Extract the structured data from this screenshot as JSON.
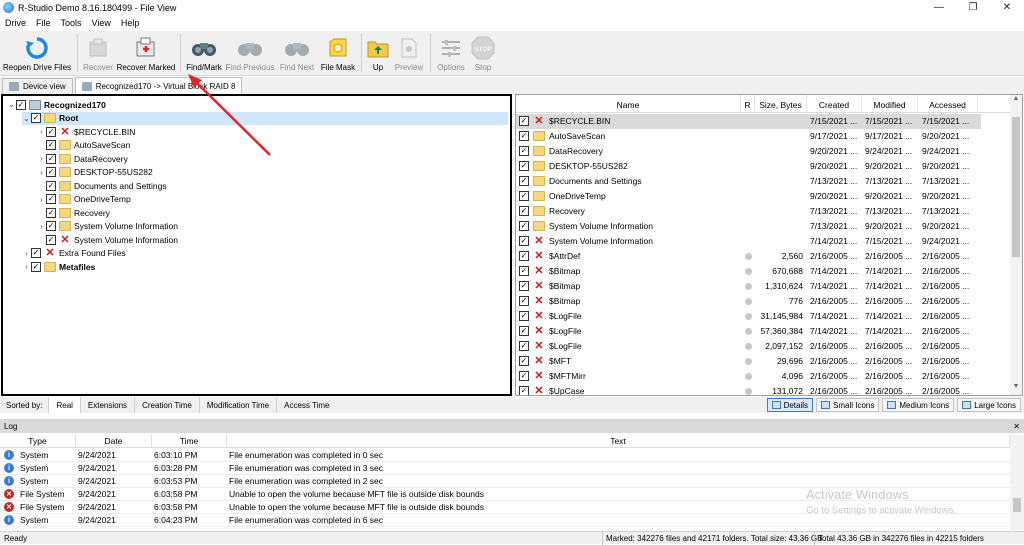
{
  "window": {
    "title": "R-Studio Demo 8.16.180499 - File View",
    "minimize": "—",
    "maximize": "❐",
    "close": "✕"
  },
  "menu": [
    "Drive",
    "File",
    "Tools",
    "View",
    "Help"
  ],
  "toolbar": [
    {
      "label": "Reopen Drive Files",
      "icon": "reopen-icon",
      "enabled": true
    },
    {
      "label": "Recover",
      "icon": "recover-icon",
      "enabled": false
    },
    {
      "label": "Recover Marked",
      "icon": "recover-marked-icon",
      "enabled": true
    },
    {
      "label": "Find/Mark",
      "icon": "binoculars-icon",
      "enabled": true
    },
    {
      "label": "Find Previous",
      "icon": "binoculars-icon",
      "enabled": false
    },
    {
      "label": "Find Next",
      "icon": "binoculars-icon",
      "enabled": false
    },
    {
      "label": "File Mask",
      "icon": "file-mask-icon",
      "enabled": true
    },
    {
      "label": "Up",
      "icon": "folder-up-icon",
      "enabled": true
    },
    {
      "label": "Preview",
      "icon": "preview-icon",
      "enabled": false
    },
    {
      "label": "Options",
      "icon": "options-icon",
      "enabled": false
    },
    {
      "label": "Stop",
      "icon": "stop-icon",
      "enabled": false,
      "badge": "STOP"
    }
  ],
  "tabs": [
    {
      "label": "Device view",
      "active": false
    },
    {
      "label": "Recognized170 -> Virtual Block RAID 8",
      "active": true
    }
  ],
  "tree": [
    {
      "label": "Recognized170",
      "level": 0,
      "expander": "⌄",
      "checked": true,
      "icon": "drive",
      "bold": true
    },
    {
      "label": "Root",
      "level": 1,
      "expander": "⌄",
      "checked": true,
      "icon": "folder",
      "bold": true,
      "selected": true
    },
    {
      "label": "$RECYCLE.BIN",
      "level": 2,
      "expander": "›",
      "checked": true,
      "icon": "deleted"
    },
    {
      "label": "AutoSaveScan",
      "level": 2,
      "expander": "",
      "checked": true,
      "icon": "folder"
    },
    {
      "label": "DataRecovery",
      "level": 2,
      "expander": "›",
      "checked": true,
      "icon": "folder"
    },
    {
      "label": "DESKTOP-55US282",
      "level": 2,
      "expander": "›",
      "checked": true,
      "icon": "folder"
    },
    {
      "label": "Documents and Settings",
      "level": 2,
      "expander": "",
      "checked": true,
      "icon": "folder"
    },
    {
      "label": "OneDriveTemp",
      "level": 2,
      "expander": "›",
      "checked": true,
      "icon": "folder"
    },
    {
      "label": "Recovery",
      "level": 2,
      "expander": "",
      "checked": true,
      "icon": "folder"
    },
    {
      "label": "System Volume Information",
      "level": 2,
      "expander": "›",
      "checked": true,
      "icon": "folder"
    },
    {
      "label": "System Volume Information",
      "level": 2,
      "expander": "",
      "checked": true,
      "icon": "deleted"
    },
    {
      "label": "Extra Found Files",
      "level": 1,
      "expander": "›",
      "checked": true,
      "icon": "deleted"
    },
    {
      "label": "Metafiles",
      "level": 1,
      "expander": "›",
      "checked": true,
      "icon": "folder",
      "bold": true
    }
  ],
  "file_columns": [
    "Name",
    "R",
    "Size, Bytes",
    "Created",
    "Modified",
    "Accessed"
  ],
  "files": [
    {
      "name": "$RECYCLE.BIN",
      "icon": "deleted",
      "r": "",
      "size": "",
      "created": "7/15/2021 ...",
      "modified": "7/15/2021 ...",
      "accessed": "7/15/2021 ...",
      "selected": true
    },
    {
      "name": "AutoSaveScan",
      "icon": "folder",
      "r": "",
      "size": "",
      "created": "9/17/2021 ...",
      "modified": "9/17/2021 ...",
      "accessed": "9/20/2021 ..."
    },
    {
      "name": "DataRecovery",
      "icon": "folder",
      "r": "",
      "size": "",
      "created": "9/20/2021 ...",
      "modified": "9/24/2021 ...",
      "accessed": "9/24/2021 ..."
    },
    {
      "name": "DESKTOP-55US282",
      "icon": "folder",
      "r": "",
      "size": "",
      "created": "9/20/2021 ...",
      "modified": "9/20/2021 ...",
      "accessed": "9/20/2021 ..."
    },
    {
      "name": "Documents and Settings",
      "icon": "folder",
      "r": "",
      "size": "",
      "created": "7/13/2021 ...",
      "modified": "7/13/2021 ...",
      "accessed": "7/13/2021 ..."
    },
    {
      "name": "OneDriveTemp",
      "icon": "folder",
      "r": "",
      "size": "",
      "created": "9/20/2021 ...",
      "modified": "9/20/2021 ...",
      "accessed": "9/20/2021 ..."
    },
    {
      "name": "Recovery",
      "icon": "folder",
      "r": "",
      "size": "",
      "created": "7/13/2021 ...",
      "modified": "7/13/2021 ...",
      "accessed": "7/13/2021 ..."
    },
    {
      "name": "System Volume Information",
      "icon": "folder",
      "r": "",
      "size": "",
      "created": "7/13/2021 ...",
      "modified": "9/20/2021 ...",
      "accessed": "9/20/2021 ..."
    },
    {
      "name": "System Volume Information",
      "icon": "deleted",
      "r": "",
      "size": "",
      "created": "7/14/2021 ...",
      "modified": "7/15/2021 ...",
      "accessed": "9/24/2021 ..."
    },
    {
      "name": "$AttrDef",
      "icon": "deleted-file",
      "r": "dot",
      "size": "2,560",
      "created": "2/16/2005 ...",
      "modified": "2/16/2005 ...",
      "accessed": "2/16/2005 ..."
    },
    {
      "name": "$Bitmap",
      "icon": "deleted-file",
      "r": "dot",
      "size": "670,688",
      "created": "7/14/2021 ...",
      "modified": "7/14/2021 ...",
      "accessed": "2/16/2005 ..."
    },
    {
      "name": "$Bitmap",
      "icon": "deleted-file",
      "r": "dot",
      "size": "1,310,624",
      "created": "7/14/2021 ...",
      "modified": "7/14/2021 ...",
      "accessed": "2/16/2005 ..."
    },
    {
      "name": "$Bitmap",
      "icon": "deleted-file",
      "r": "dot",
      "size": "776",
      "created": "2/16/2005 ...",
      "modified": "2/16/2005 ...",
      "accessed": "2/16/2005 ..."
    },
    {
      "name": "$LogFile",
      "icon": "deleted-file",
      "r": "dot",
      "size": "31,145,984",
      "created": "7/14/2021 ...",
      "modified": "7/14/2021 ...",
      "accessed": "2/16/2005 ..."
    },
    {
      "name": "$LogFile",
      "icon": "deleted-file",
      "r": "dot",
      "size": "57,360,384",
      "created": "7/14/2021 ...",
      "modified": "7/14/2021 ...",
      "accessed": "2/16/2005 ..."
    },
    {
      "name": "$LogFile",
      "icon": "deleted-file",
      "r": "dot",
      "size": "2,097,152",
      "created": "2/16/2005 ...",
      "modified": "2/16/2005 ...",
      "accessed": "2/16/2005 ..."
    },
    {
      "name": "$MFT",
      "icon": "deleted-file",
      "r": "dot",
      "size": "29,696",
      "created": "2/16/2005 ...",
      "modified": "2/16/2005 ...",
      "accessed": "2/16/2005 ..."
    },
    {
      "name": "$MFTMirr",
      "icon": "deleted-file",
      "r": "dot",
      "size": "4,096",
      "created": "2/16/2005 ...",
      "modified": "2/16/2005 ...",
      "accessed": "2/16/2005 ..."
    },
    {
      "name": "$UpCase",
      "icon": "deleted-file",
      "r": "dot",
      "size": "131,072",
      "created": "2/16/2005 ...",
      "modified": "2/16/2005 ...",
      "accessed": "2/16/2005 ..."
    }
  ],
  "sort": {
    "label": "Sorted by:",
    "tabs": [
      "Real",
      "Extensions",
      "Creation Time",
      "Modification Time",
      "Access Time"
    ],
    "active": "Real"
  },
  "views": [
    {
      "label": "Details",
      "active": true
    },
    {
      "label": "Small Icons",
      "active": false
    },
    {
      "label": "Medium Icons",
      "active": false
    },
    {
      "label": "Large Icons",
      "active": false
    }
  ],
  "log": {
    "title": "Log",
    "close": "✕",
    "columns": [
      "Type",
      "Date",
      "Time",
      "Text"
    ],
    "rows": [
      {
        "level": "info",
        "type": "System",
        "date": "9/24/2021",
        "time": "6:03:10 PM",
        "text": "File enumeration was completed in 0 sec"
      },
      {
        "level": "info",
        "type": "System",
        "date": "9/24/2021",
        "time": "6:03:28 PM",
        "text": "File enumeration was completed in 3 sec"
      },
      {
        "level": "info",
        "type": "System",
        "date": "9/24/2021",
        "time": "6:03:53 PM",
        "text": "File enumeration was completed in 2 sec"
      },
      {
        "level": "error",
        "type": "File System",
        "date": "9/24/2021",
        "time": "6:03:58 PM",
        "text": "Unable to open the volume because MFT file is outside disk bounds"
      },
      {
        "level": "error",
        "type": "File System",
        "date": "9/24/2021",
        "time": "6:03:58 PM",
        "text": "Unable to open the volume because MFT file is outside disk bounds"
      },
      {
        "level": "info",
        "type": "System",
        "date": "9/24/2021",
        "time": "6:04:23 PM",
        "text": "File enumeration was completed in 6 sec"
      }
    ]
  },
  "watermark": {
    "line1": "Activate Windows",
    "line2": "Go to Settings to activate Windows."
  },
  "status": {
    "ready": "Ready",
    "marked": "Marked: 342276 files and 42171 folders. Total size: 43.36 GB",
    "total": "Total 43.36 GB in 342276 files in 42215 folders"
  },
  "colors": {
    "arrow": "#e0262a",
    "selection": "#cfe6fb",
    "deleted": "#d01818",
    "folder": "#f6d77e"
  }
}
